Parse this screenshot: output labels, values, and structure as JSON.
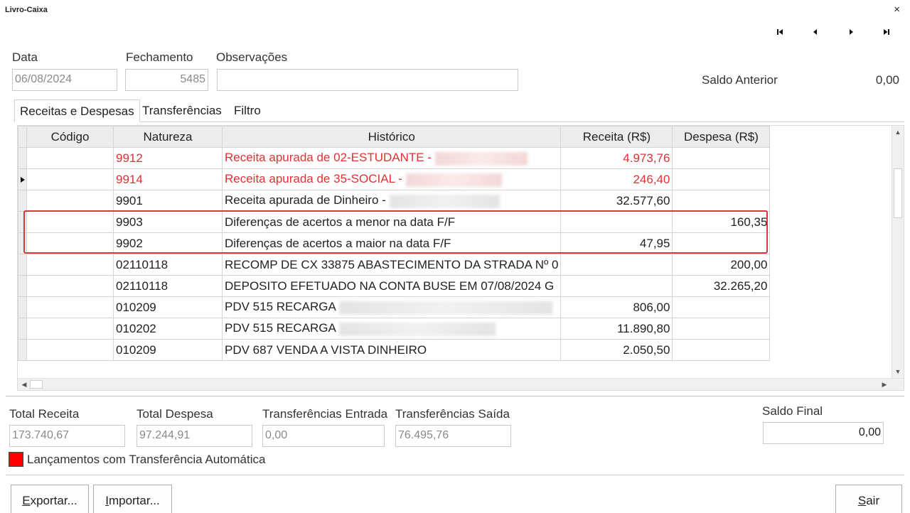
{
  "window": {
    "title": "Livro-Caixa",
    "close_glyph": "×"
  },
  "navigation": [
    "first-record-icon",
    "previous-record-icon",
    "next-record-icon",
    "last-record-icon"
  ],
  "header": {
    "data_label": "Data",
    "data_value": "06/08/2024",
    "fechamento_label": "Fechamento",
    "fechamento_value": "5485",
    "observacoes_label": "Observações",
    "observacoes_value": "",
    "saldo_anterior_label": "Saldo Anterior",
    "saldo_anterior_value": "0,00"
  },
  "tabs": [
    "Receitas e Despesas",
    "Transferências",
    "Filtro"
  ],
  "grid": {
    "columns": [
      "Código",
      "Natureza",
      "Histórico",
      "Receita (R$)",
      "Despesa (R$)"
    ],
    "rows": [
      {
        "codigo": "",
        "natureza": "9912",
        "historico": "Receita apurada de 02-ESTUDANTE - ",
        "receita": "4.973,76",
        "despesa": "",
        "red": true,
        "redacted": true
      },
      {
        "codigo": "",
        "natureza": "9914",
        "historico": "Receita apurada de 35-SOCIAL - ",
        "receita": "246,40",
        "despesa": "",
        "red": true,
        "redacted": true,
        "current": true
      },
      {
        "codigo": "",
        "natureza": "9901",
        "historico": "Receita apurada de Dinheiro - ",
        "receita": "32.577,60",
        "despesa": "",
        "red": false,
        "redacted": true
      },
      {
        "codigo": "",
        "natureza": "9903",
        "historico": "Diferenças de acertos a menor na data F/F",
        "receita": "",
        "despesa": "160,35",
        "red": false,
        "redacted": false
      },
      {
        "codigo": "",
        "natureza": "9902",
        "historico": "Diferenças de acertos a maior na data F/F",
        "receita": "47,95",
        "despesa": "",
        "red": false,
        "redacted": false
      },
      {
        "codigo": "",
        "natureza": "02110118",
        "historico": "RECOMP DE CX 33875 ABASTECIMENTO DA STRADA Nº 0",
        "receita": "",
        "despesa": "200,00",
        "red": false,
        "redacted": false
      },
      {
        "codigo": "",
        "natureza": "02110118",
        "historico": "DEPOSITO EFETUADO NA CONTA BUSE EM 07/08/2024 G",
        "receita": "",
        "despesa": "32.265,20",
        "red": false,
        "redacted": false
      },
      {
        "codigo": "",
        "natureza": "010209",
        "historico": "PDV 515 RECARGA ",
        "receita": "806,00",
        "despesa": "",
        "red": false,
        "redacted": true
      },
      {
        "codigo": "",
        "natureza": "010202",
        "historico": "PDV 515 RECARGA ",
        "receita": "11.890,80",
        "despesa": "",
        "red": false,
        "redacted": true
      },
      {
        "codigo": "",
        "natureza": "010209",
        "historico": "PDV 687 VENDA A VISTA DINHEIRO",
        "receita": "2.050,50",
        "despesa": "",
        "red": false,
        "redacted": false
      }
    ]
  },
  "totals": {
    "total_receita_label": "Total Receita",
    "total_receita_value": "173.740,67",
    "total_despesa_label": "Total Despesa",
    "total_despesa_value": "97.244,91",
    "transf_entrada_label": "Transferências Entrada",
    "transf_entrada_value": "0,00",
    "transf_saida_label": "Transferências Saída",
    "transf_saida_value": "76.495,76",
    "saldo_final_label": "Saldo Final",
    "saldo_final_value": "0,00"
  },
  "legend": {
    "label": "Lançamentos com Transferência Automática",
    "color": "#ff0000"
  },
  "buttons": {
    "exportar_hotkey": "E",
    "exportar_rest": "xportar...",
    "importar_hotkey": "I",
    "importar_rest": "mportar...",
    "sair_hotkey": "S",
    "sair_rest": "air"
  },
  "colors": {
    "red_text": "#e03131",
    "highlight": "#d9373b"
  }
}
